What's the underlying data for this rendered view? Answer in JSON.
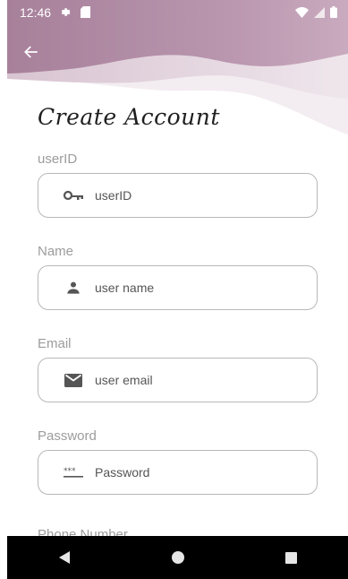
{
  "status_bar": {
    "time": "12:46",
    "icons": [
      "gear-icon",
      "sd-card-icon",
      "wifi-icon",
      "signal-icon",
      "battery-icon"
    ]
  },
  "header": {
    "back_icon": "arrow-back-icon",
    "title": "Create Account"
  },
  "form": {
    "fields": [
      {
        "label": "userID",
        "placeholder": "userID",
        "icon": "key-icon"
      },
      {
        "label": "Name",
        "placeholder": "user name",
        "icon": "person-icon"
      },
      {
        "label": "Email",
        "placeholder": "user email",
        "icon": "mail-icon"
      },
      {
        "label": "Password",
        "placeholder": "Password",
        "icon": "password-icon"
      }
    ],
    "next_label_partial": "Phone Number"
  },
  "nav_bar": {
    "buttons": [
      "back-triangle-icon",
      "home-circle-icon",
      "recents-square-icon"
    ]
  },
  "colors": {
    "wave_dark": "#a97e99",
    "wave_mid": "#c9aabe",
    "wave_light": "#ece1e8",
    "border": "#b8b8b8",
    "label": "#9c9c9c"
  }
}
